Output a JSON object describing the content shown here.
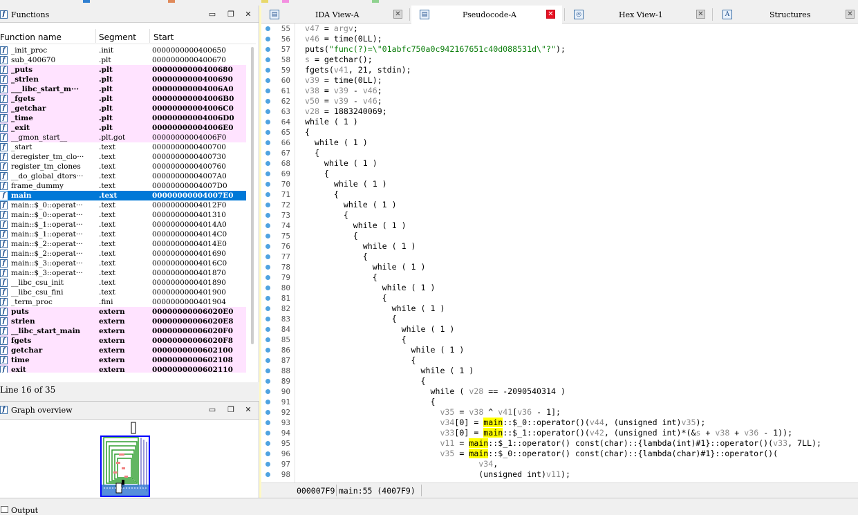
{
  "functions_panel": {
    "title": "Functions",
    "columns": {
      "name": "Function name",
      "segment": "Segment",
      "start": "Start"
    },
    "status": "Line 16 of 35",
    "rows": [
      {
        "name": "_init_proc",
        "segment": ".init",
        "start": "0000000000400650",
        "kind": "normal"
      },
      {
        "name": "sub_400670",
        "segment": ".plt",
        "start": "0000000000400670",
        "kind": "normal"
      },
      {
        "name": "_puts",
        "segment": ".plt",
        "start": "0000000000400680",
        "kind": "lib"
      },
      {
        "name": "_strlen",
        "segment": ".plt",
        "start": "0000000000400690",
        "kind": "lib"
      },
      {
        "name": "___libc_start_m···",
        "segment": ".plt",
        "start": "00000000004006A0",
        "kind": "lib"
      },
      {
        "name": "_fgets",
        "segment": ".plt",
        "start": "00000000004006B0",
        "kind": "lib"
      },
      {
        "name": "_getchar",
        "segment": ".plt",
        "start": "00000000004006C0",
        "kind": "lib"
      },
      {
        "name": "_time",
        "segment": ".plt",
        "start": "00000000004006D0",
        "kind": "lib"
      },
      {
        "name": "_exit",
        "segment": ".plt",
        "start": "00000000004006E0",
        "kind": "lib"
      },
      {
        "name": "__gmon_start__",
        "segment": ".plt.got",
        "start": "00000000004006F0",
        "kind": "libplain"
      },
      {
        "name": "_start",
        "segment": ".text",
        "start": "0000000000400700",
        "kind": "normal"
      },
      {
        "name": "deregister_tm_clo···",
        "segment": ".text",
        "start": "0000000000400730",
        "kind": "normal"
      },
      {
        "name": "register_tm_clones",
        "segment": ".text",
        "start": "0000000000400760",
        "kind": "normal"
      },
      {
        "name": "__do_global_dtors···",
        "segment": ".text",
        "start": "00000000004007A0",
        "kind": "normal"
      },
      {
        "name": "frame_dummy",
        "segment": ".text",
        "start": "00000000004007D0",
        "kind": "normal"
      },
      {
        "name": "main",
        "segment": ".text",
        "start": "00000000004007E0",
        "kind": "selected"
      },
      {
        "name": "main::$_0::operat···",
        "segment": ".text",
        "start": "00000000004012F0",
        "kind": "normal"
      },
      {
        "name": "main::$_0::operat···",
        "segment": ".text",
        "start": "0000000000401310",
        "kind": "normal"
      },
      {
        "name": "main::$_1::operat···",
        "segment": ".text",
        "start": "00000000004014A0",
        "kind": "normal"
      },
      {
        "name": "main::$_1::operat···",
        "segment": ".text",
        "start": "00000000004014C0",
        "kind": "normal"
      },
      {
        "name": "main::$_2::operat···",
        "segment": ".text",
        "start": "00000000004014E0",
        "kind": "normal"
      },
      {
        "name": "main::$_2::operat···",
        "segment": ".text",
        "start": "0000000000401690",
        "kind": "normal"
      },
      {
        "name": "main::$_3::operat···",
        "segment": ".text",
        "start": "00000000004016C0",
        "kind": "normal"
      },
      {
        "name": "main::$_3::operat···",
        "segment": ".text",
        "start": "0000000000401870",
        "kind": "normal"
      },
      {
        "name": "__libc_csu_init",
        "segment": ".text",
        "start": "0000000000401890",
        "kind": "normal"
      },
      {
        "name": "__libc_csu_fini",
        "segment": ".text",
        "start": "0000000000401900",
        "kind": "normal"
      },
      {
        "name": "_term_proc",
        "segment": ".fini",
        "start": "0000000000401904",
        "kind": "normal"
      },
      {
        "name": "puts",
        "segment": "extern",
        "start": "00000000006020E0",
        "kind": "lib"
      },
      {
        "name": "strlen",
        "segment": "extern",
        "start": "00000000006020E8",
        "kind": "lib"
      },
      {
        "name": "__libc_start_main",
        "segment": "extern",
        "start": "00000000006020F0",
        "kind": "lib"
      },
      {
        "name": "fgets",
        "segment": "extern",
        "start": "00000000006020F8",
        "kind": "lib"
      },
      {
        "name": "getchar",
        "segment": "extern",
        "start": "0000000000602100",
        "kind": "lib"
      },
      {
        "name": "time",
        "segment": "extern",
        "start": "0000000000602108",
        "kind": "lib"
      },
      {
        "name": "exit",
        "segment": "extern",
        "start": "0000000000602110",
        "kind": "lib"
      }
    ]
  },
  "graph_panel": {
    "title": "Graph overview"
  },
  "tabs": [
    {
      "label": "IDA View-A",
      "icon": "ida-view-icon",
      "active": false
    },
    {
      "label": "Pseudocode-A",
      "icon": "pseudocode-icon",
      "active": true
    },
    {
      "label": "Hex View-1",
      "icon": "hex-view-icon",
      "active": false
    },
    {
      "label": "Structures",
      "icon": "structures-icon",
      "active": false
    }
  ],
  "code_lines": [
    {
      "n": "55",
      "html": "<span class='v'>v47</span> = <span class='v'>argv</span>;"
    },
    {
      "n": "56",
      "html": "<span class='v'>v46</span> = time(0LL);"
    },
    {
      "n": "57",
      "html": "puts(<span class='s'>\"func(?)=\\\"01abfc750a0c942167651c40d088531d\\\"?\"</span>);"
    },
    {
      "n": "58",
      "html": "<span class='v'>s</span> = getchar();"
    },
    {
      "n": "59",
      "html": "fgets(<span class='v'>v41</span>, 21, stdin);"
    },
    {
      "n": "60",
      "html": "<span class='v'>v39</span> = time(0LL);"
    },
    {
      "n": "61",
      "html": "<span class='v'>v38</span> = <span class='v'>v39</span> - <span class='v'>v46</span>;"
    },
    {
      "n": "62",
      "html": "<span class='v'>v50</span> = <span class='v'>v39</span> - <span class='v'>v46</span>;"
    },
    {
      "n": "63",
      "html": "<span class='v'>v28</span> = 1883240069;"
    },
    {
      "n": "64",
      "html": "while ( 1 )"
    },
    {
      "n": "65",
      "html": "{"
    },
    {
      "n": "66",
      "html": "  while ( 1 )"
    },
    {
      "n": "67",
      "html": "  {"
    },
    {
      "n": "68",
      "html": "    while ( 1 )"
    },
    {
      "n": "69",
      "html": "    {"
    },
    {
      "n": "70",
      "html": "      while ( 1 )"
    },
    {
      "n": "71",
      "html": "      {"
    },
    {
      "n": "72",
      "html": "        while ( 1 )"
    },
    {
      "n": "73",
      "html": "        {"
    },
    {
      "n": "74",
      "html": "          while ( 1 )"
    },
    {
      "n": "75",
      "html": "          {"
    },
    {
      "n": "76",
      "html": "            while ( 1 )"
    },
    {
      "n": "77",
      "html": "            {"
    },
    {
      "n": "78",
      "html": "              while ( 1 )"
    },
    {
      "n": "79",
      "html": "              {"
    },
    {
      "n": "80",
      "html": "                while ( 1 )"
    },
    {
      "n": "81",
      "html": "                {"
    },
    {
      "n": "82",
      "html": "                  while ( 1 )"
    },
    {
      "n": "83",
      "html": "                  {"
    },
    {
      "n": "84",
      "html": "                    while ( 1 )"
    },
    {
      "n": "85",
      "html": "                    {"
    },
    {
      "n": "86",
      "html": "                      while ( 1 )"
    },
    {
      "n": "87",
      "html": "                      {"
    },
    {
      "n": "88",
      "html": "                        while ( 1 )"
    },
    {
      "n": "89",
      "html": "                        {"
    },
    {
      "n": "90",
      "html": "                          while ( <span class='v'>v28</span> == -2090540314 )"
    },
    {
      "n": "91",
      "html": "                          {"
    },
    {
      "n": "92",
      "html": "                            <span class='v'>v35</span> = <span class='v'>v38</span> ^ <span class='v'>v41</span>[<span class='v'>v36</span> - 1];"
    },
    {
      "n": "93",
      "html": "                            <span class='v'>v34</span>[0] = <span class='h'>main</span>::$_0::operator()(<span class='v'>v44</span>, (unsigned int)<span class='v'>v35</span>);"
    },
    {
      "n": "94",
      "html": "                            <span class='v'>v33</span>[0] = <span class='h'>main</span>::$_1::operator()(<span class='v'>v42</span>, (unsigned int)*(&amp;<span class='v'>s</span> + <span class='v'>v38</span> + <span class='v'>v36</span> - 1));"
    },
    {
      "n": "95",
      "html": "                            <span class='v'>v11</span> = <span class='h'>main</span>::$_1::operator() const(char)::{lambda(int)#1}::operator()(<span class='v'>v33</span>, 7LL);"
    },
    {
      "n": "96",
      "html": "                            <span class='v'>v35</span> = <span class='h'>main</span>::$_0::operator() const(char)::{lambda(char)#1}::operator()("
    },
    {
      "n": "97",
      "html": "                                    <span class='v'>v34</span>,"
    },
    {
      "n": "98",
      "html": "                                    (unsigned int)<span class='v'>v11</span>);"
    }
  ],
  "code_status": {
    "address": "000007F9",
    "location": "main:55 (4007F9)"
  },
  "output": {
    "title": "Output"
  },
  "colors": {
    "selection": "#0078d7",
    "library_row": "#ffe3ff",
    "highlight": "#ffff00",
    "breakpoint_dot": "#4fa3e0",
    "close_active": "#e81123"
  }
}
